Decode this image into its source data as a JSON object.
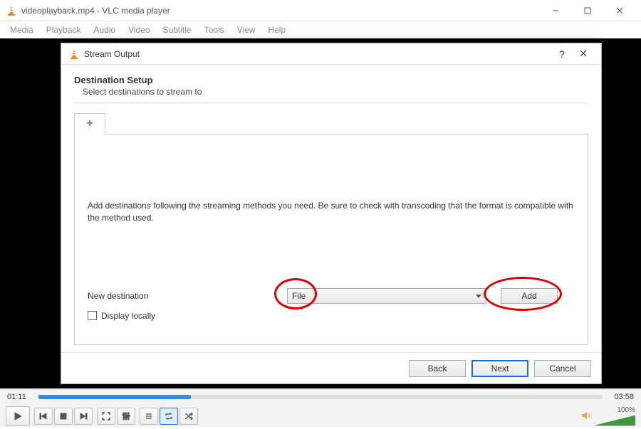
{
  "window": {
    "title": "videoplayback.mp4 - VLC media player"
  },
  "menu": {
    "media": "Media",
    "playback": "Playback",
    "audio": "Audio",
    "video": "Video",
    "subtitle": "Subtitle",
    "tools": "Tools",
    "view": "View",
    "help": "Help"
  },
  "dialog": {
    "title": "Stream Output",
    "help": "?",
    "section_title": "Destination Setup",
    "section_sub": "Select destinations to stream to",
    "tab_plus": "+",
    "instruction": "Add destinations following the streaming methods you need. Be sure to check with transcoding that the format is compatible with the method used.",
    "new_dest_label": "New destination",
    "dest_value": "File",
    "add_label": "Add",
    "display_locally": "Display locally",
    "back": "Back",
    "next": "Next",
    "cancel": "Cancel"
  },
  "player": {
    "elapsed": "01:11",
    "total": "03:58",
    "progress_pct": 27,
    "volume_pct": "100%"
  }
}
